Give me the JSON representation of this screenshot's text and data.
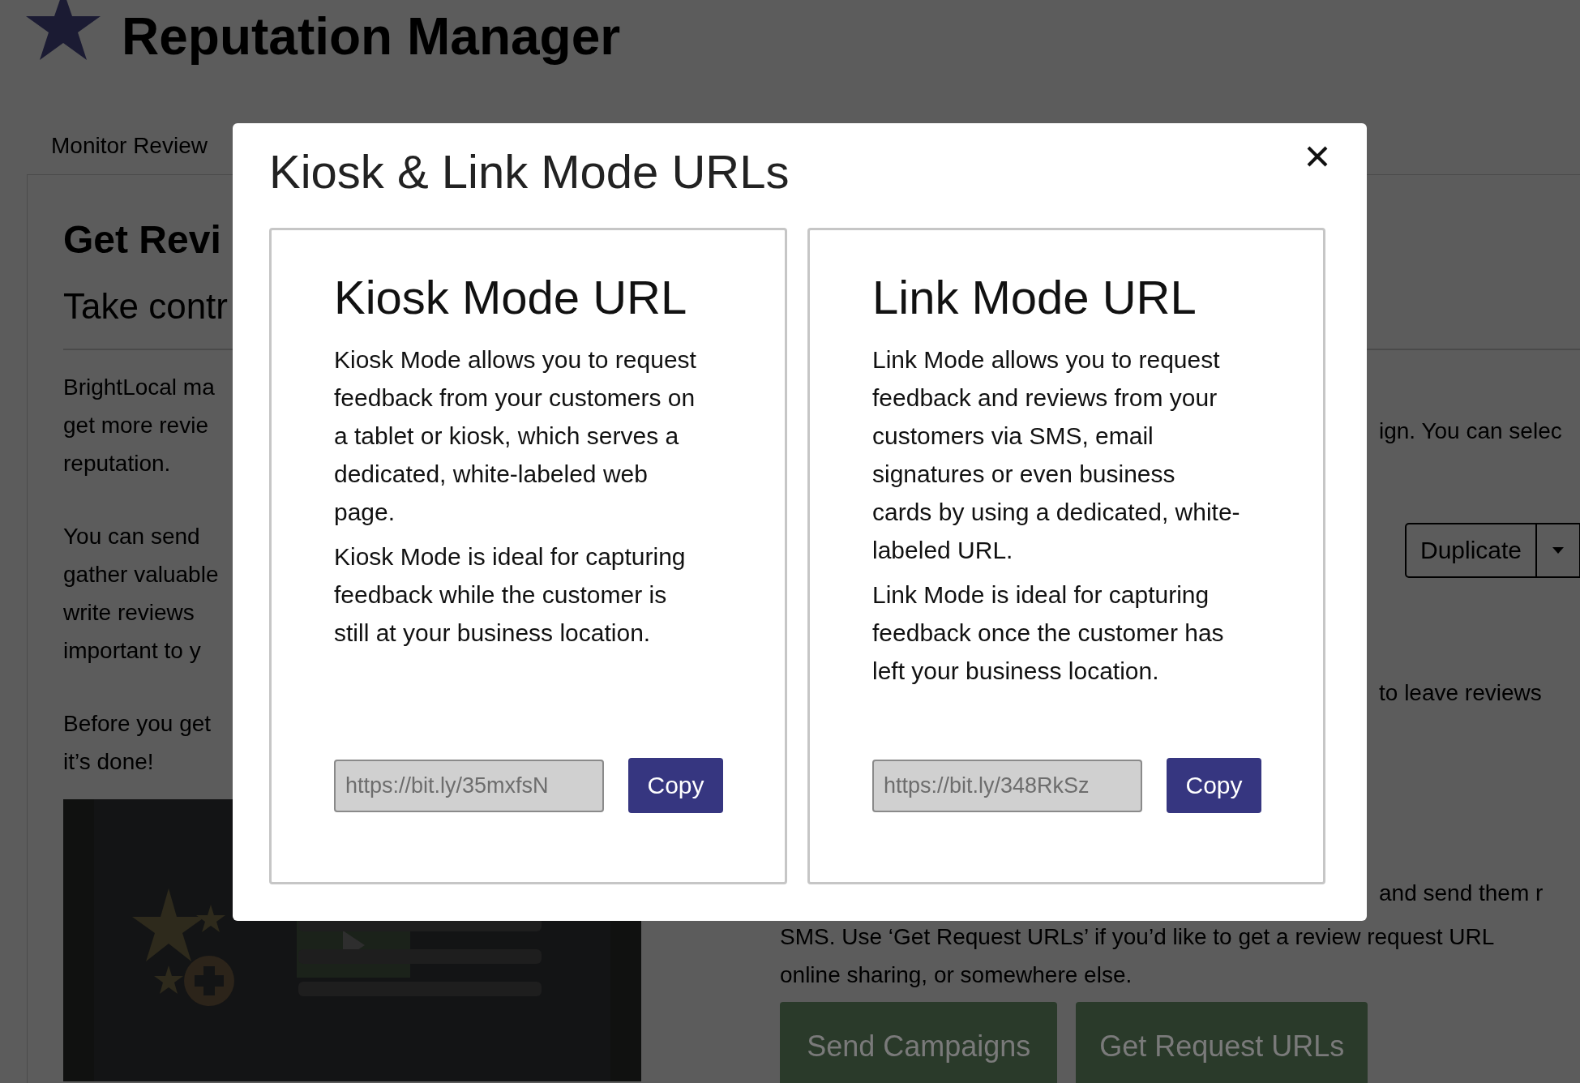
{
  "header": {
    "title": "Reputation Manager"
  },
  "tab_label": "Monitor Review",
  "content": {
    "heading": "Get Revi",
    "subheading": "Take contr",
    "left_lines": [
      [
        "BrightLocal ma",
        "get more revie",
        "reputation."
      ],
      [
        "You can send",
        "gather valuable",
        "write reviews",
        "important to y"
      ],
      [
        "Before you get",
        "it’s done!"
      ]
    ],
    "video": {
      "kind": "picture"
    },
    "right_lines": [
      "ign. You can selec",
      "to leave reviews",
      "and send them r"
    ],
    "duplicate_button": "Duplicate",
    "bottom_lines": [
      "SMS. Use ‘Get Request URLs’ if you’d like to get a review request URL",
      "online sharing, or somewhere else."
    ],
    "action_buttons": [
      "Send Campaigns",
      "Get Request URLs"
    ]
  },
  "modal": {
    "title": "Kiosk & Link Mode URLs",
    "cards": [
      {
        "heading": "Kiosk Mode URL",
        "paragraphs": [
          "Kiosk Mode allows you to request feedback from your customers on a tablet or kiosk, which serves a dedicated, white-labeled web page.",
          "Kiosk Mode is ideal for capturing feedback while the customer is still at your business location."
        ],
        "url": "https://bit.ly/35mxfsN",
        "button": "Copy"
      },
      {
        "heading": "Link Mode URL",
        "paragraphs": [
          "Link Mode allows you to request feedback and reviews from your customers via SMS, email signatures or even business cards by using a dedicated, white-labeled URL.",
          "Link Mode is ideal for capturing feedback once the customer has left your business location."
        ],
        "url": "https://bit.ly/348RkSz",
        "button": "Copy"
      }
    ]
  }
}
